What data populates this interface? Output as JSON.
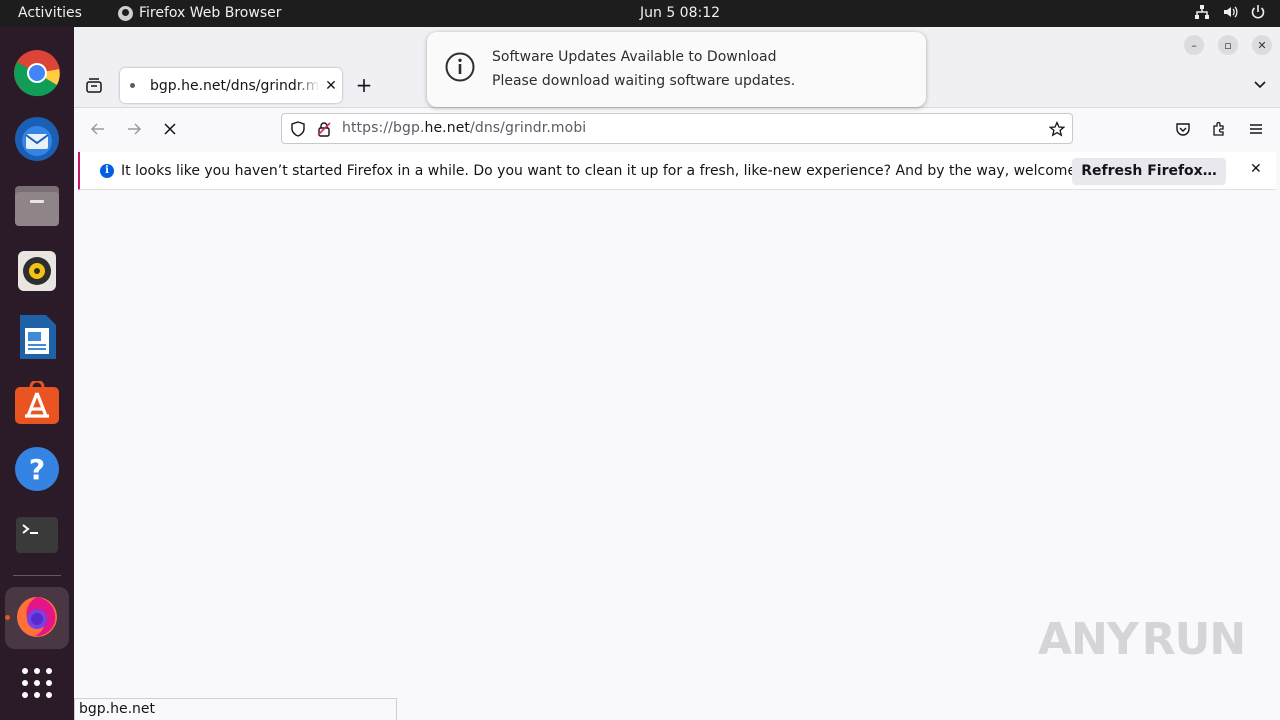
{
  "topbar": {
    "activities": "Activities",
    "app_name": "Firefox Web Browser",
    "clock": "Jun 5  08:12"
  },
  "dock": {
    "items": [
      "Google Chrome",
      "Thunderbird Mail",
      "Files",
      "Rhythmbox",
      "LibreOffice Writer",
      "Ubuntu Software",
      "Help",
      "Terminal",
      "Firefox Web Browser",
      "Show Applications"
    ]
  },
  "browser": {
    "tab": {
      "title": "bgp.he.net/dns/grindr.mobi",
      "close_icon": "close-icon"
    },
    "url": {
      "prefix": "https://bgp.",
      "host": "he.net",
      "path": "/dns/grindr.mobi"
    },
    "notice": {
      "message": "It looks like you haven’t started Firefox in a while. Do you want to clean it up for a fresh, like-new experience? And by the way, welcome back!",
      "button": "Refresh Firefox…"
    },
    "status": "bgp.he.net"
  },
  "toast": {
    "title": "Software Updates Available to Download",
    "body": "Please download waiting software updates."
  },
  "watermark": {
    "left": "ANY",
    "right": "RUN"
  }
}
